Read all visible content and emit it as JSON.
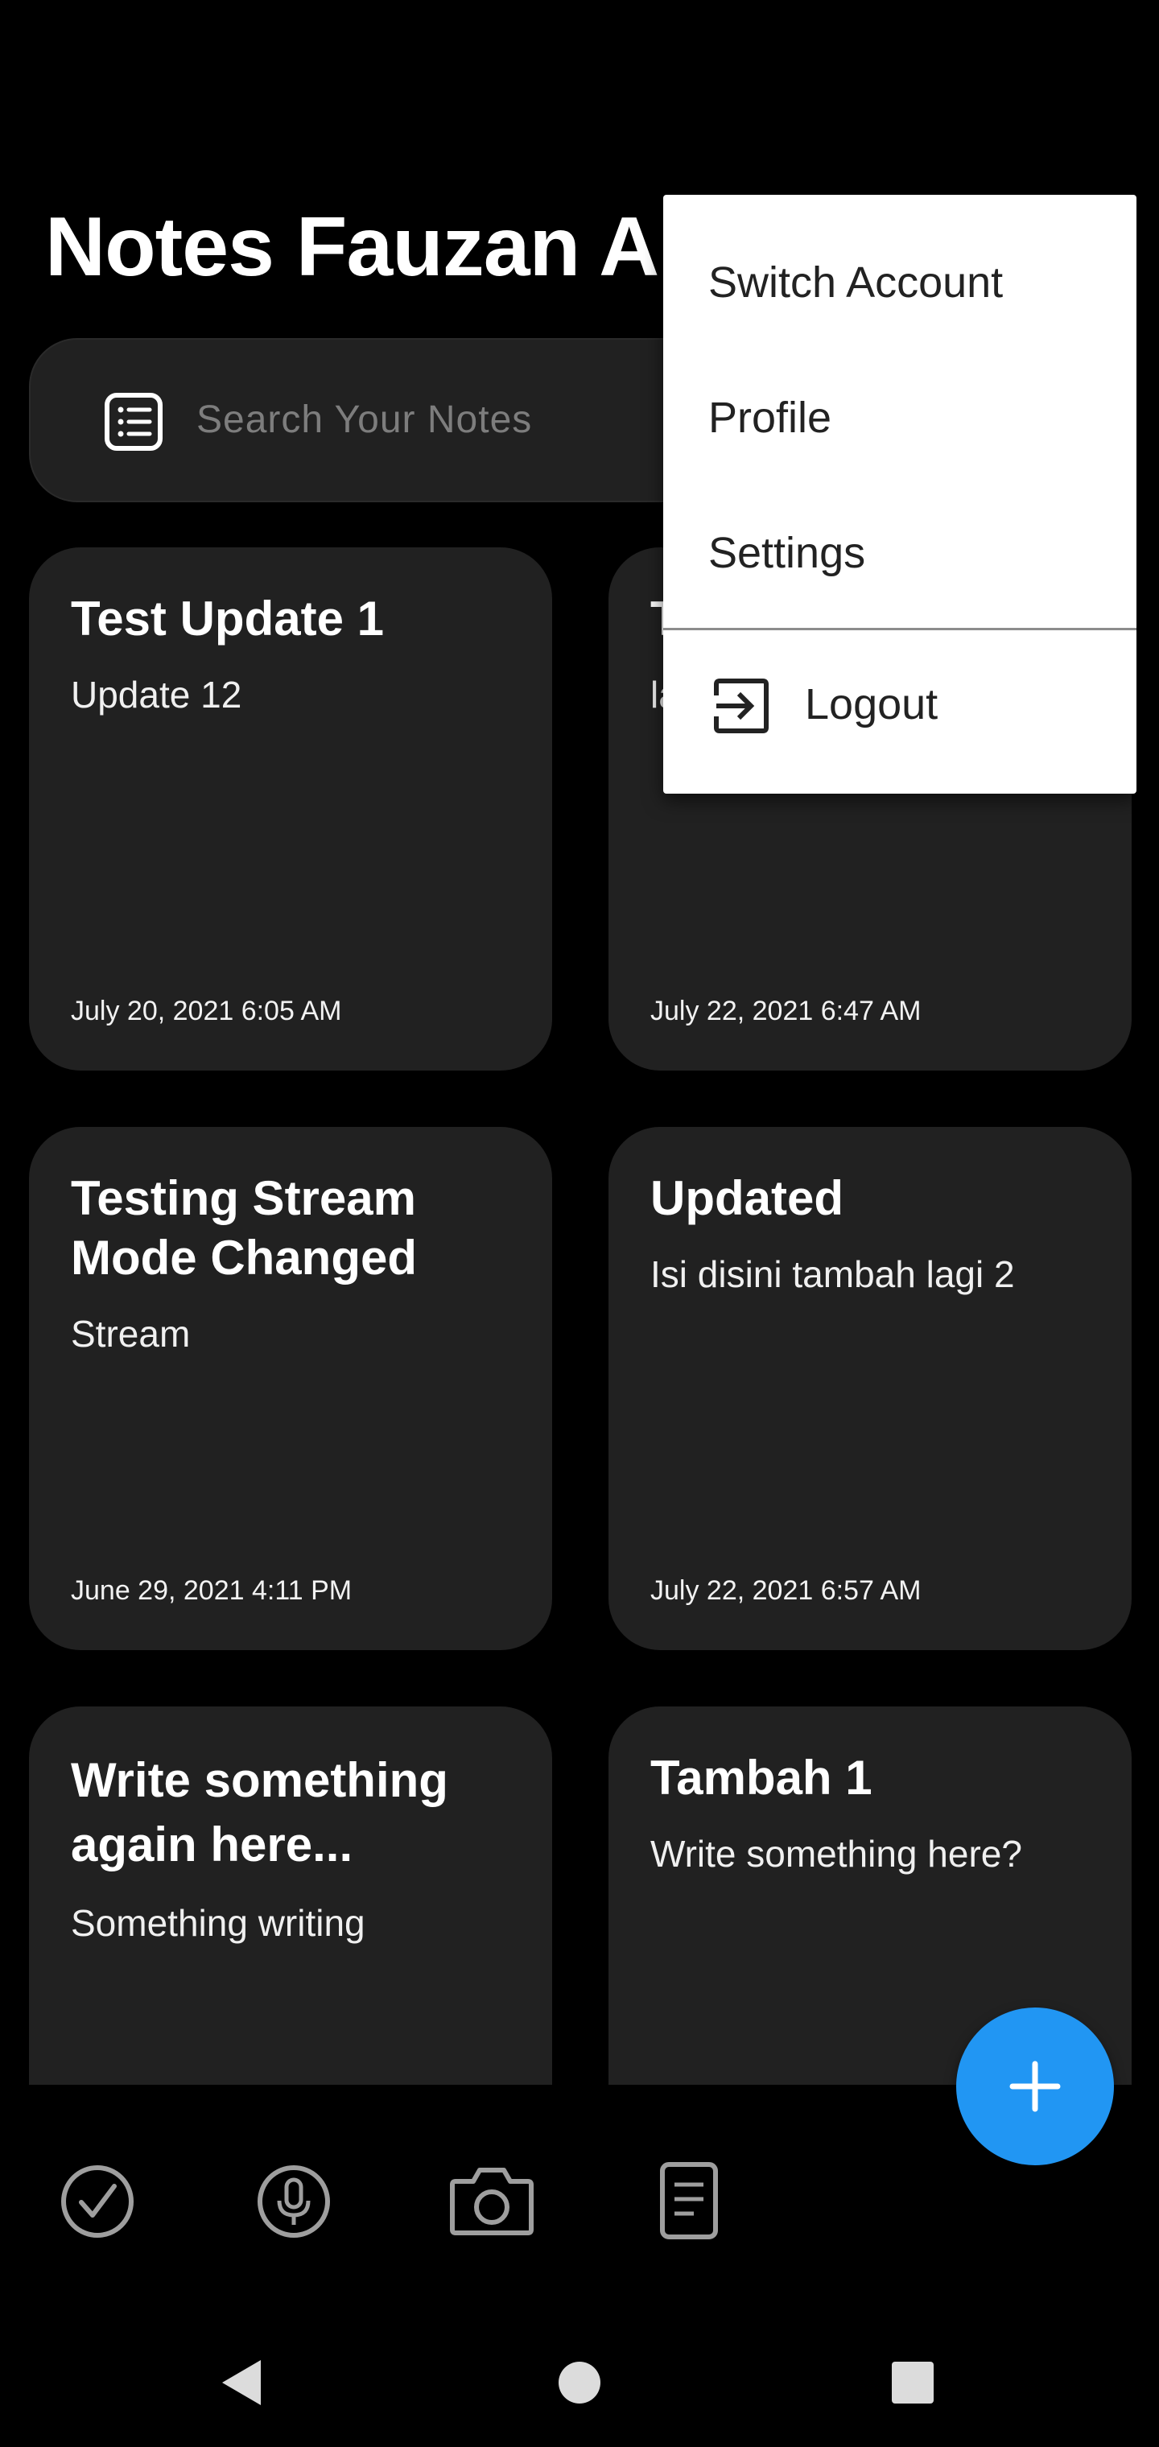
{
  "app": {
    "title": "Notes Fauzan Al"
  },
  "search": {
    "placeholder": "Search Your Notes",
    "icon": "notes-list-icon"
  },
  "notes": [
    {
      "title": "Test Update 1",
      "body": "Update 12",
      "date": "July 20, 2021 6:05 AM"
    },
    {
      "title": "T",
      "body": "la",
      "date": "July 22, 2021 6:47 AM"
    },
    {
      "title": "Testing Stream Mode Changed",
      "body": "Stream",
      "date": "June 29, 2021 4:11 PM"
    },
    {
      "title": "Updated",
      "body": "Isi disini tambah lagi 2",
      "date": "July 22, 2021 6:57 AM"
    },
    {
      "title": "Write something again here...",
      "body": "Something writing",
      "date": ""
    },
    {
      "title": "Tambah 1",
      "body": "Write something here?",
      "date": ""
    }
  ],
  "menu": {
    "items": [
      "Switch Account",
      "Profile",
      "Settings"
    ],
    "logout_label": "Logout"
  },
  "bottom_bar": {
    "icons": [
      "checklist-icon",
      "microphone-icon",
      "camera-icon",
      "document-icon"
    ]
  },
  "fab": {
    "icon": "plus-icon"
  },
  "colors": {
    "background": "#000000",
    "card": "#212121",
    "accent": "#2196f3",
    "menu_bg": "#ffffff",
    "placeholder": "#7d7d7d"
  }
}
